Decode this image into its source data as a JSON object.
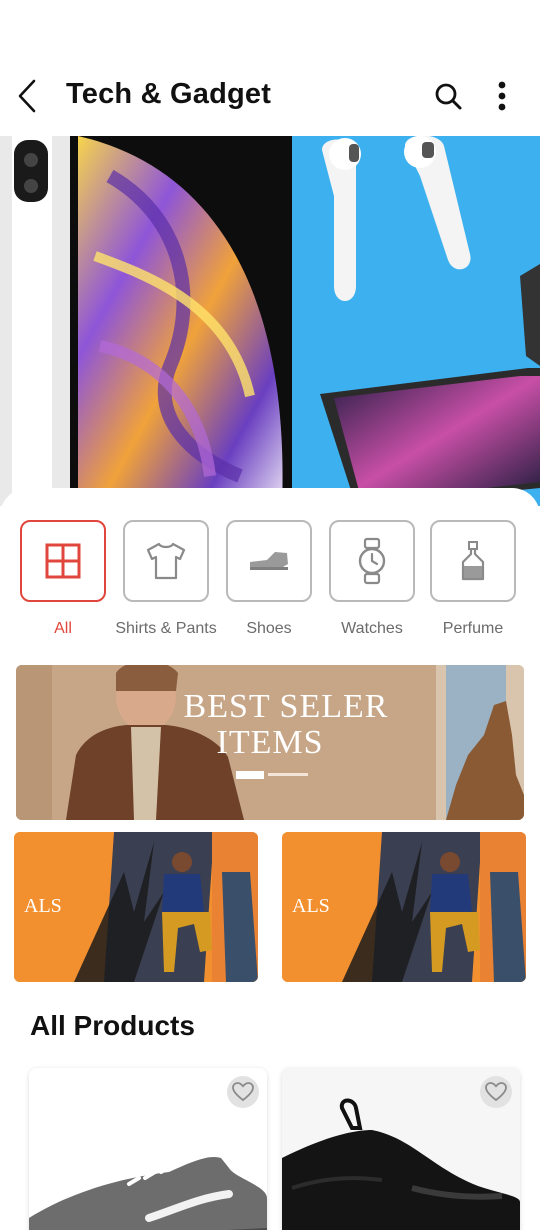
{
  "app_bar": {
    "title": "Tech & Gadget",
    "back_icon": "chevron-left-icon",
    "search_icon": "search-icon",
    "more_icon": "more-vertical-icon"
  },
  "hero": {
    "description_icon": "hero-banner-image"
  },
  "categories": [
    {
      "label": "All",
      "icon": "grid-icon",
      "active": true
    },
    {
      "label": "Shirts & Pants",
      "icon": "tshirt-icon",
      "active": false
    },
    {
      "label": "Shoes",
      "icon": "shoe-icon",
      "active": false
    },
    {
      "label": "Watches",
      "icon": "watch-icon",
      "active": false
    },
    {
      "label": "Perfume",
      "icon": "perfume-icon",
      "active": false
    }
  ],
  "promos": {
    "main_text_line1": "BEST SELER",
    "main_text_line2": "ITEMS",
    "small_text": "ALS"
  },
  "section": {
    "title": "All Products"
  },
  "colors": {
    "accent": "#e0463b",
    "inactive_border": "#b9b9b9",
    "inactive_label": "#6b6b6b"
  }
}
